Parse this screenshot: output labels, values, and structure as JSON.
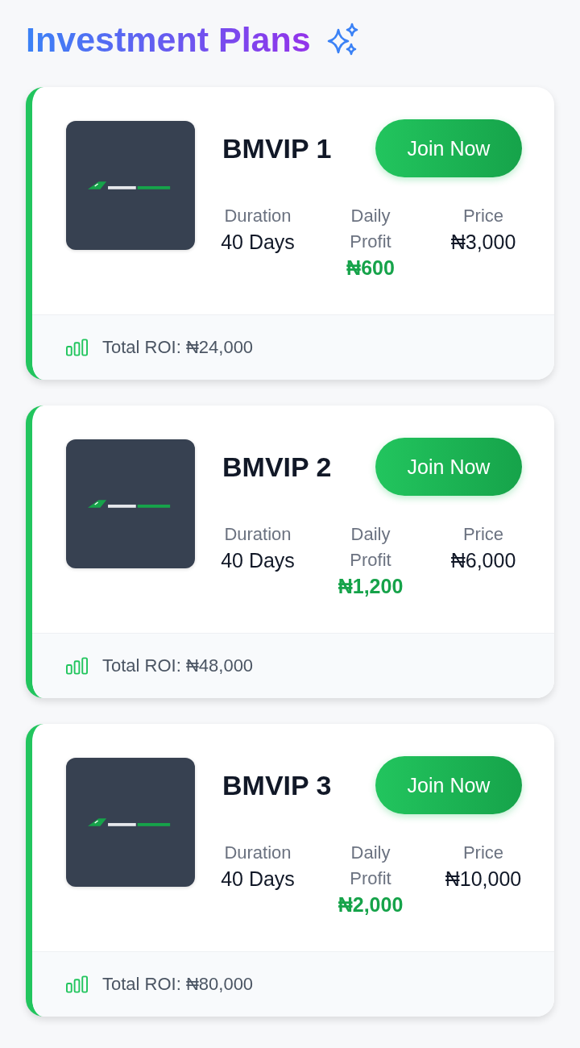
{
  "title": "Investment Plans",
  "plans": [
    {
      "name": "BMVIP 1",
      "button": "Join Now",
      "stats": [
        {
          "label": "Duration",
          "value": "40 Days",
          "kind": "plain"
        },
        {
          "label": "Daily Profit",
          "value": "₦600",
          "kind": "profit"
        },
        {
          "label": "Price",
          "value": "₦3,000",
          "kind": "plain"
        }
      ],
      "roi": "Total ROI: ₦24,000"
    },
    {
      "name": "BMVIP 2",
      "button": "Join Now",
      "stats": [
        {
          "label": "Duration",
          "value": "40 Days",
          "kind": "plain"
        },
        {
          "label": "Daily Profit",
          "value": "₦1,200",
          "kind": "profit"
        },
        {
          "label": "Price",
          "value": "₦6,000",
          "kind": "plain"
        }
      ],
      "roi": "Total ROI: ₦48,000"
    },
    {
      "name": "BMVIP 3",
      "button": "Join Now",
      "stats": [
        {
          "label": "Duration",
          "value": "40 Days",
          "kind": "plain"
        },
        {
          "label": "Daily Profit",
          "value": "₦2,000",
          "kind": "profit"
        },
        {
          "label": "Price",
          "value": "₦10,000",
          "kind": "plain"
        }
      ],
      "roi": "Total ROI: ₦80,000"
    }
  ]
}
